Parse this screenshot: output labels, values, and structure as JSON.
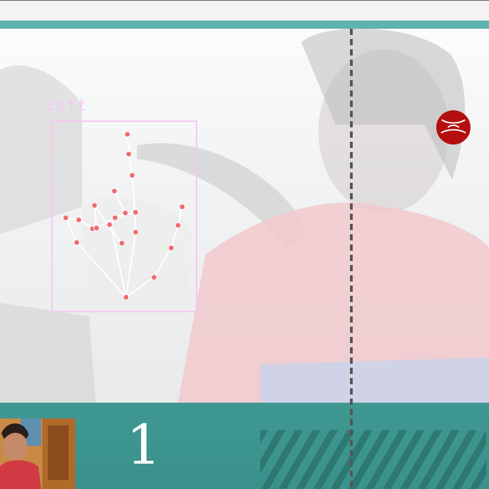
{
  "app": {
    "title": ""
  },
  "game": {
    "score": "1",
    "hand_label": "Left",
    "ball": {
      "color": "#b30f0f"
    },
    "colors": {
      "accent_teal": "#5fb3ae",
      "bottom_bar": "#3e9891",
      "hand_box": "#f7c6f3",
      "landmark": "#f06a70"
    }
  },
  "icons": {
    "ball": "red-ball-icon",
    "thumbnail": "webcam-thumbnail"
  }
}
